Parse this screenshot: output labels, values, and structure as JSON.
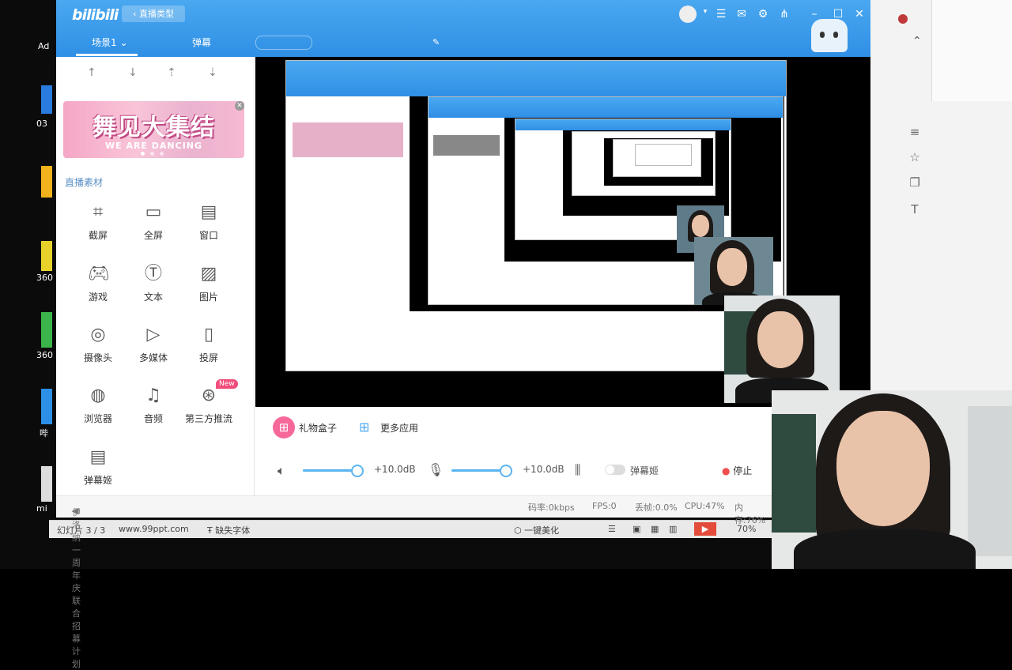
{
  "desktop": {
    "labels": [
      "Ad",
      "03",
      "360",
      "360",
      "哔",
      "mi"
    ]
  },
  "app": {
    "logo": "bilibili",
    "back_button": "直播类型",
    "tabs": {
      "scene": "场景1",
      "danmaku": "弹幕"
    },
    "sidebar": {
      "banner_title": "舞见大集结",
      "banner_subtitle": "WE ARE DANCING",
      "section_label": "直播素材",
      "tools": [
        {
          "label": "截屏",
          "icon": "crop-icon"
        },
        {
          "label": "全屏",
          "icon": "monitor-icon"
        },
        {
          "label": "窗口",
          "icon": "window-icon"
        },
        {
          "label": "游戏",
          "icon": "gamepad-icon"
        },
        {
          "label": "文本",
          "icon": "text-icon"
        },
        {
          "label": "图片",
          "icon": "image-icon"
        },
        {
          "label": "摄像头",
          "icon": "camera-icon"
        },
        {
          "label": "多媒体",
          "icon": "media-icon"
        },
        {
          "label": "投屏",
          "icon": "phone-icon"
        },
        {
          "label": "浏览器",
          "icon": "browser-icon"
        },
        {
          "label": "音频",
          "icon": "music-icon"
        },
        {
          "label": "第三方推流",
          "icon": "stream-icon"
        },
        {
          "label": "弹幕姬",
          "icon": "chat-icon"
        }
      ],
      "new_badge": "New"
    },
    "bottom": {
      "gift_box": "礼物盒子",
      "more_apps": "更多应用",
      "speaker_db": "+10.0dB",
      "mic_db": "+10.0dB",
      "speaker_level": 0.9,
      "mic_level": 0.9,
      "danmaku_toggle": "弹幕姬",
      "stop": "停止"
    },
    "status": {
      "news": "伊洛纳 一周年庆联合招募计划",
      "bitrate": "码率:0kbps",
      "fps": "FPS:0",
      "drop": "丢帧:0.0%",
      "cpu": "CPU:47%",
      "mem": "内存:76%"
    }
  },
  "ppt": {
    "slide": "幻灯片 3 / 3",
    "site": "www.99ppt.com",
    "missing_font": "缺失字体",
    "beautify": "一键美化",
    "zoom": "70%"
  },
  "colors": {
    "accent": "#2f8fe5",
    "pink": "#f04d7b",
    "section": "#5a8fc5"
  }
}
